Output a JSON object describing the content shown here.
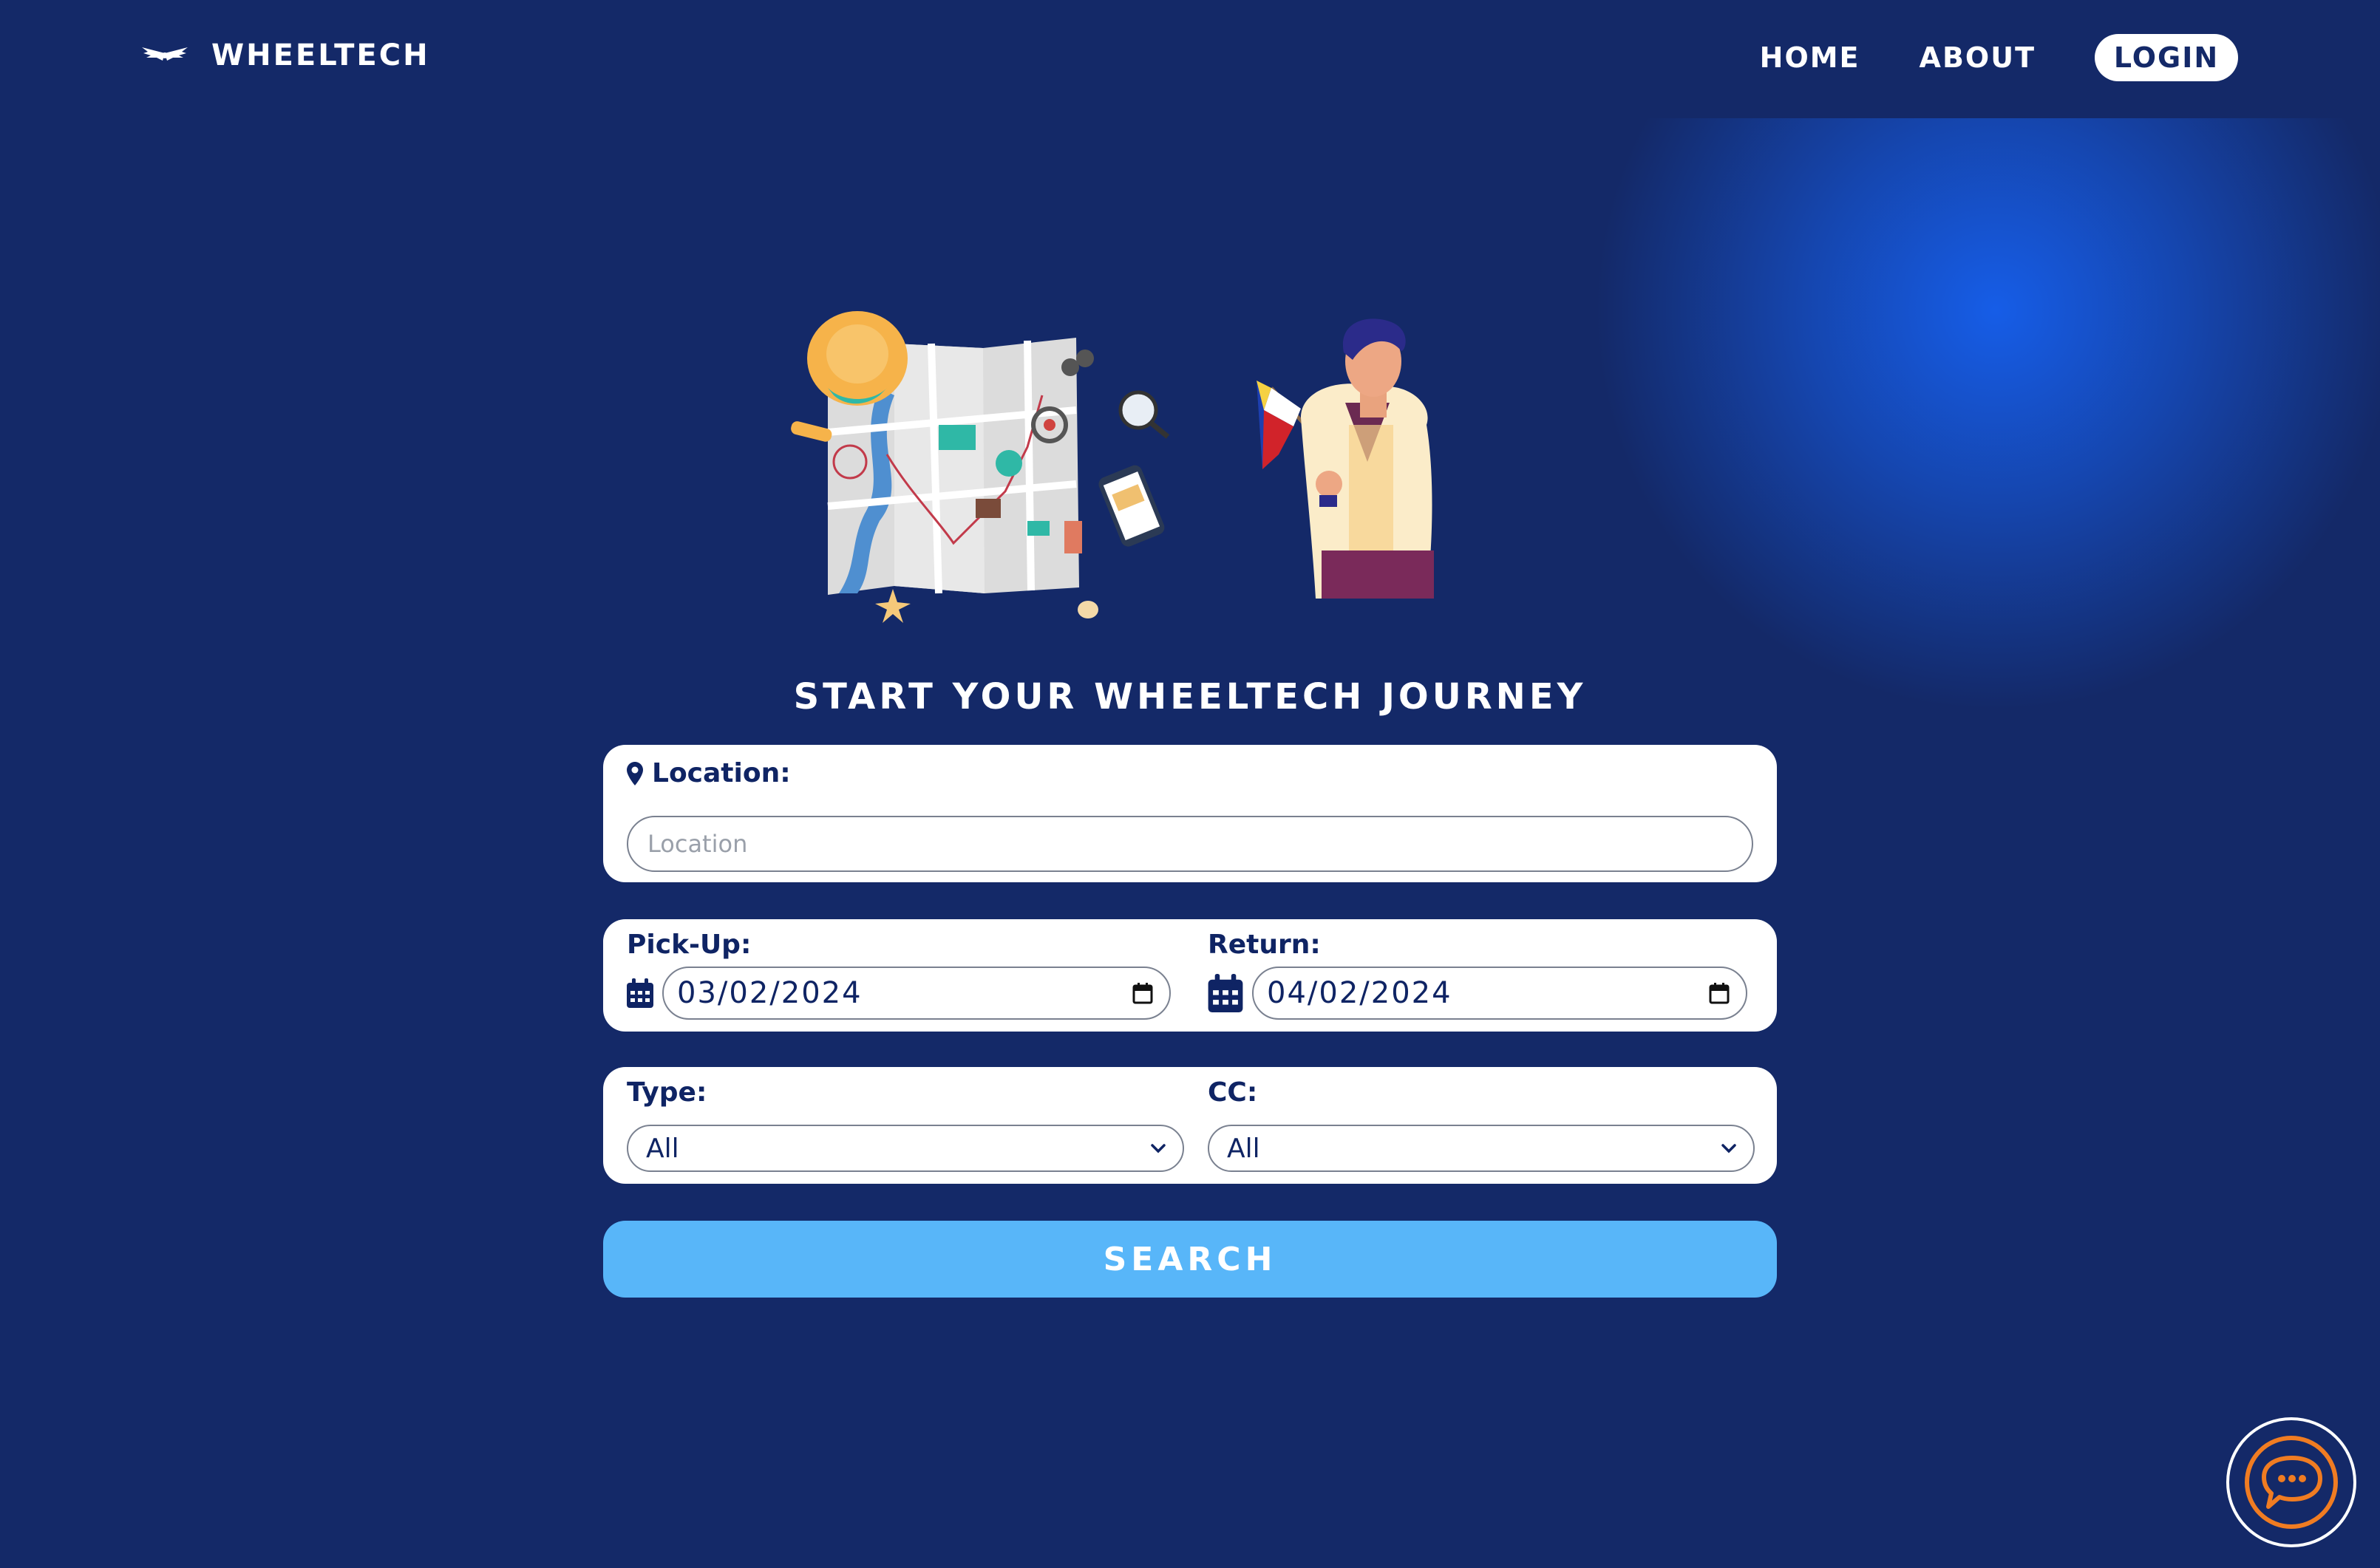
{
  "brand": {
    "name": "WHEELTECH"
  },
  "nav": {
    "home": "HOME",
    "about": "ABOUT",
    "login": "LOGIN"
  },
  "hero": {
    "headline": "START YOUR WHEELTECH JOURNEY"
  },
  "form": {
    "location": {
      "label": "Location:",
      "placeholder": "Location",
      "value": ""
    },
    "pickup": {
      "label": "Pick-Up:",
      "value": "03/02/2024"
    },
    "return": {
      "label": "Return:",
      "value": "04/02/2024"
    },
    "type": {
      "label": "Type:",
      "selected": "All"
    },
    "cc": {
      "label": "CC:",
      "selected": "All"
    },
    "search_label": "SEARCH"
  },
  "colors": {
    "background": "#142968",
    "glow": "#1660ee",
    "search_button": "#58b6f9",
    "card": "#ffffff",
    "chat_accent": "#f07c22"
  },
  "icons": [
    "wings-logo-icon",
    "location-pin-icon",
    "calendar-icon",
    "chevron-down-icon",
    "chat-bubble-icon"
  ]
}
